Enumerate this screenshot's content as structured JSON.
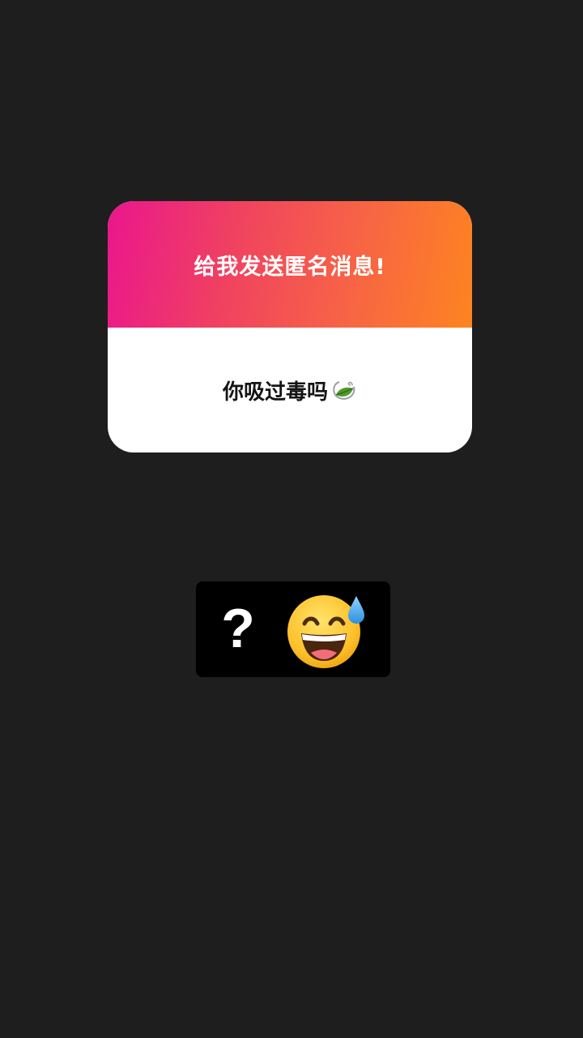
{
  "question_card": {
    "title": "给我发送匿名消息!",
    "answer": "你吸过毒吗",
    "answer_icon": "leaf-icon",
    "gradient_colors": [
      "#ea168d",
      "#fd8420"
    ]
  },
  "sticker": {
    "text": "?",
    "emoji_icon": "grinning-face-with-sweat-icon"
  }
}
